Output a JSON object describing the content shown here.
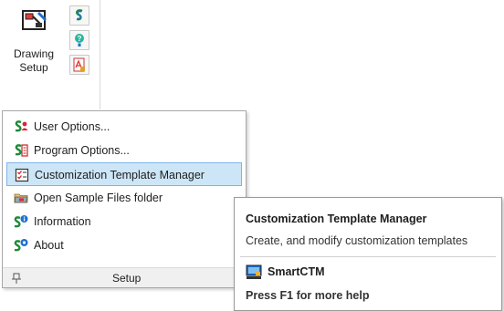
{
  "ribbon": {
    "drawing_setup_label_line1": "Drawing",
    "drawing_setup_label_line2": "Setup"
  },
  "menu": {
    "items": [
      {
        "label": "User Options...",
        "icon": "user-options-icon"
      },
      {
        "label": "Program Options...",
        "icon": "program-options-icon"
      },
      {
        "label": "Customization Template Manager",
        "icon": "template-manager-icon",
        "highlighted": true
      },
      {
        "label": "Open Sample Files folder",
        "icon": "folder-icon"
      },
      {
        "label": "Information",
        "icon": "information-icon"
      },
      {
        "label": "About",
        "icon": "about-icon"
      }
    ],
    "footer_label": "Setup"
  },
  "tooltip": {
    "title": "Customization Template Manager",
    "description": "Create, and modify customization templates",
    "command": "SmartCTM",
    "help": "Press F1 for more help"
  },
  "colors": {
    "highlight_bg": "#cde6f7",
    "highlight_border": "#7eb4ea",
    "brand_green": "#1f8a3a",
    "brand_blue": "#1e6fd0"
  }
}
